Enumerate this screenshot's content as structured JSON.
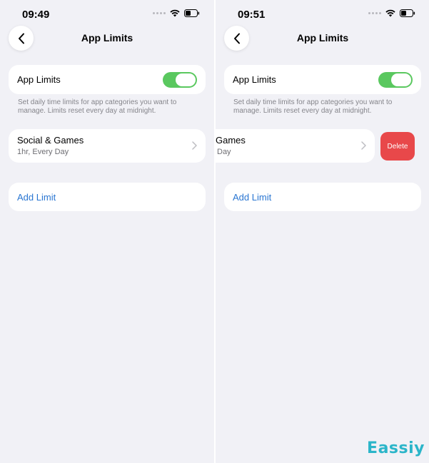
{
  "left": {
    "status": {
      "time": "09:49"
    },
    "nav": {
      "title": "App Limits"
    },
    "toggle": {
      "label": "App Limits",
      "state": "on"
    },
    "description": "Set daily time limits for app categories you want to manage. Limits reset every day at midnight.",
    "limit_item": {
      "title": "Social & Games",
      "subtitle": "1hr, Every Day"
    },
    "add_limit": "Add Limit"
  },
  "right": {
    "status": {
      "time": "09:51"
    },
    "nav": {
      "title": "App Limits"
    },
    "toggle": {
      "label": "App Limits",
      "state": "on"
    },
    "description": "Set daily time limits for app categories you want to manage. Limits reset every day at midnight.",
    "limit_item": {
      "title": "Games",
      "subtitle": "Day"
    },
    "delete_label": "Delete",
    "add_limit": "Add Limit"
  },
  "watermark": "Eassiy",
  "icons": {
    "back": "chevron-left-icon",
    "wifi": "wifi-icon",
    "battery": "battery-icon",
    "cellular": "cellular-dots-icon",
    "disclosure": "chevron-right-icon"
  },
  "colors": {
    "background": "#f1f1f6",
    "toggle_on": "#5ac85f",
    "link": "#2a76d2",
    "delete": "#e8484a",
    "watermark": "#2bb5c9"
  }
}
